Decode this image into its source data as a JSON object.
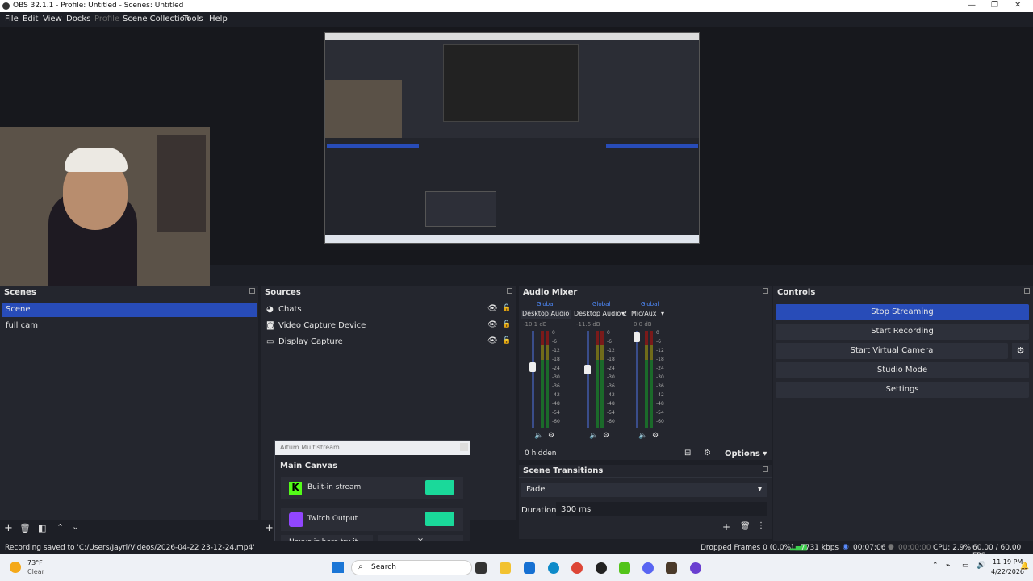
{
  "window": {
    "title": "OBS 32.1.1 - Profile: Untitled - Scenes: Untitled"
  },
  "menu": [
    "File",
    "Edit",
    "View",
    "Docks",
    "Profile",
    "Scene Collection",
    "Tools",
    "Help"
  ],
  "scenes": {
    "title": "Scenes",
    "items": [
      "Scene",
      "full cam"
    ]
  },
  "sources": {
    "title": "Sources",
    "items": [
      "Chats",
      "Video Capture Device",
      "Display Capture"
    ]
  },
  "mixer": {
    "title": "Audio Mixer",
    "channels": [
      {
        "global": "Global",
        "name": "Desktop Audio",
        "db": "-10.1 dB"
      },
      {
        "global": "Global",
        "name": "Desktop Audio 2",
        "db": "-11.6 dB"
      },
      {
        "global": "Global",
        "name": "Mic/Aux",
        "db": "0.0 dB"
      }
    ],
    "ticks": [
      "0",
      "-6",
      "-12",
      "-18",
      "-24",
      "-30",
      "-36",
      "-42",
      "-48",
      "-54",
      "-60"
    ],
    "hidden": "0 hidden",
    "options": "Options"
  },
  "transitions": {
    "title": "Scene Transitions",
    "selected": "Fade",
    "duration_label": "Duration",
    "duration": "300 ms"
  },
  "controls": {
    "title": "Controls",
    "buttons": [
      "Stop Streaming",
      "Start Recording",
      "Start Virtual Camera",
      "Studio Mode",
      "Settings"
    ]
  },
  "aitum": {
    "title": "Aitum Multistream",
    "section": "Main Canvas",
    "outputs": [
      "Built-in stream",
      "Twitch Output"
    ],
    "notice": "Nexus is here try it now"
  },
  "status": {
    "recording": "Recording saved to 'C:/Users/Jayri/Videos/2026-04-22 23-12-24.mp4'",
    "dropped": "Dropped Frames 0 (0.0%)",
    "kbps": "7731 kbps",
    "stream_time": "00:07:06",
    "rec_time": "00:00:00",
    "cpu": "CPU: 2.9%",
    "fps": "60.00 / 60.00 FPS"
  },
  "taskbar": {
    "temp": "73°F",
    "weather": "Clear",
    "search": "Search",
    "time": "11:19 PM",
    "date": "4/22/2026"
  }
}
